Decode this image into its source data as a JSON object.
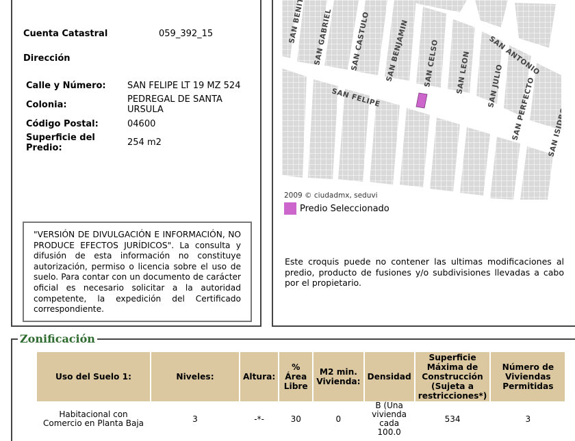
{
  "predio": {
    "cuenta_label": "Cuenta Catastral",
    "cuenta_value": "059_392_15",
    "direccion_label": "Dirección",
    "calle_label": "Calle y Número:",
    "calle_value": "SAN FELIPE LT 19 MZ 524",
    "colonia_label": "Colonia:",
    "colonia_value": "PEDREGAL DE SANTA URSULA",
    "cp_label": "Código Postal:",
    "cp_value": "04600",
    "superficie_label": "Superficie del Predio:",
    "superficie_value": "254 m2"
  },
  "notice": {
    "text": "\"VERSIÓN DE DIVULGACIÓN E INFORMACIÓN, NO PRODUCE EFECTOS JURÍDICOS\". La consulta y difusión de esta información no constituye autorización, permiso o licencia sobre el uso de suelo. Para contar con un documento de carácter oficial es necesario solicitar a la autoridad competente, la expedición del Certificado correspondiente."
  },
  "map": {
    "streets": [
      "SAN BENITO",
      "SAN GABRIEL",
      "SAN CASTULO",
      "SAN BENJAMIN",
      "SAN CELSO",
      "SAN LEON",
      "SAN JULIO",
      "SAN ANTONIO",
      "SAN PERFECTO",
      "SAN ISIDRO",
      "SAN FELIPE"
    ],
    "copyright": "2009 © ciudadmx, seduvi",
    "legend_label": "Predio Seleccionado",
    "highlight_color": "#cc66cc",
    "block_color": "#d9d9d9"
  },
  "croquis_note": "Este croquis puede no contener las ultimas modificaciones al predio, producto de fusiones y/o subdivisiones llevadas a cabo por el propietario.",
  "zonificacion": {
    "title": "Zonificación",
    "headers": [
      "Uso del Suelo 1:",
      "Niveles:",
      "Altura:",
      "% Área Libre",
      "M2 min. Vivienda:",
      "Densidad",
      "Superficie Máxima de Construcción (Sujeta a restricciones*)",
      "Número de Viviendas Permitidas"
    ],
    "row": [
      "Habitacional con Comercio en Planta Baja",
      "3",
      "-*-",
      "30",
      "0",
      "B (Una vivienda cada 100.0",
      "534",
      "3"
    ],
    "header_color": "#dcc8a0",
    "title_color": "#2e6b2e"
  }
}
